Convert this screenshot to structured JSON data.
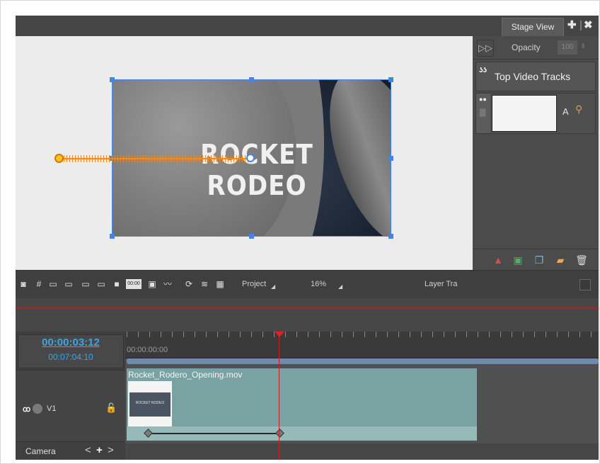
{
  "panel": {
    "tab_label": "Stage View",
    "add_icon": "plus-icon",
    "close_icon": "close-icon"
  },
  "stage": {
    "clip_title": "ROCKET RODEO"
  },
  "layers": {
    "opacity_label": "Opacity",
    "opacity_value": "100",
    "top_tracks_label": "Top Video Tracks",
    "layer_letter": "A"
  },
  "toolbar": {
    "project_label": "Project",
    "zoom_value": "16%",
    "layer_label": "Layer Tra"
  },
  "timeline": {
    "current_time": "00:00:03:12",
    "total_time": "00:07:04:10",
    "ruler_start": "00:00:00:00",
    "track_label": "V1",
    "camera_label": "Camera",
    "clip_name": "Rocket_Rodero_Opening.mov",
    "thumb_text": "ROCKET RODEO"
  },
  "colors": {
    "accent_blue": "#3f86e8",
    "timecode": "#3aa6e8",
    "playhead": "#c82020",
    "trail": "#f08a18",
    "clip_bg": "#79a3a3"
  }
}
